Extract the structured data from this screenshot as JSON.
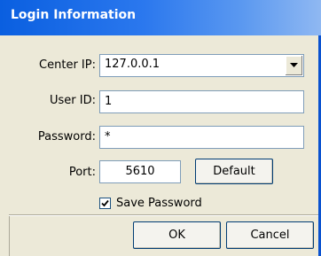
{
  "window": {
    "title": "Login Information"
  },
  "form": {
    "center_ip_label": "Center IP:",
    "center_ip_value": "127.0.0.1",
    "user_id_label": "User ID:",
    "user_id_value": "1",
    "password_label": "Password:",
    "password_value": "*",
    "port_label": "Port:",
    "port_value": "5610",
    "default_button": "Default",
    "save_password_label": "Save Password",
    "save_password_checked": true
  },
  "buttons": {
    "ok": "OK",
    "cancel": "Cancel"
  },
  "icons": {
    "dropdown": "chevron-down-icon",
    "check": "check-icon"
  },
  "colors": {
    "titlebar_start": "#0a5fe0",
    "titlebar_end": "#8fb8f2",
    "dialog_background": "#ece9d8",
    "field_border": "#7f9db9"
  }
}
